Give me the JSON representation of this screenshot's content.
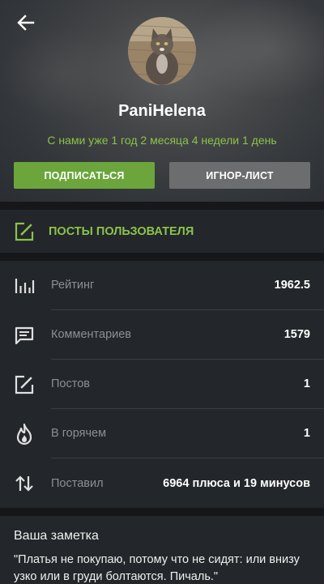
{
  "header": {
    "username": "PaniHelena",
    "member_since": "С нами уже 1 год 2 месяца 4 недели 1 день",
    "subscribe_label": "ПОДПИСАТЬСЯ",
    "ignore_label": "ИГНОР-ЛИСТ"
  },
  "posts_link": {
    "label": "ПОСТЫ ПОЛЬЗОВАТЕЛЯ"
  },
  "stats": [
    {
      "label": "Рейтинг",
      "value": "1962.5",
      "icon": "bar-chart-icon"
    },
    {
      "label": "Комментариев",
      "value": "1579",
      "icon": "comment-icon"
    },
    {
      "label": "Постов",
      "value": "1",
      "icon": "edit-icon"
    },
    {
      "label": "В горячем",
      "value": "1",
      "icon": "flame-icon"
    },
    {
      "label": "Поставил",
      "value": "6964 плюса и 19 минусов",
      "icon": "sort-arrows-icon"
    }
  ],
  "note": {
    "title": "Ваша заметка",
    "text": "\"Платья не покупаю, потому что не сидят: или внизу узко или в груди болтаются. Пичаль.\""
  },
  "colors": {
    "accent": "#8bc34a",
    "subscribe_bg": "#6ba53b",
    "ignore_bg": "#6c6d6f",
    "background": "#1f2226"
  }
}
